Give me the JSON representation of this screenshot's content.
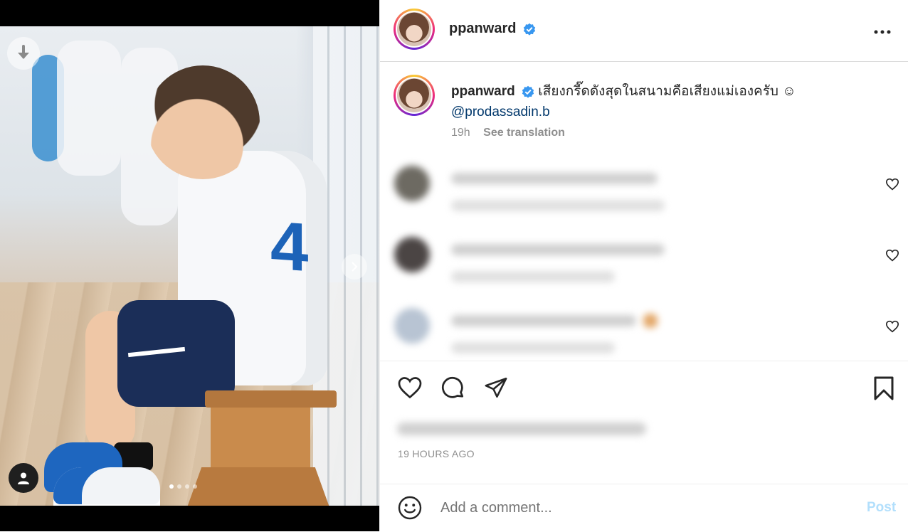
{
  "post": {
    "username": "ppanward",
    "caption": "เสียงกรี๊ดดังสุดในสนามคือเสียงแม่เองครับ ☺",
    "mention": "@prodassadin.b",
    "time_ago": "19h",
    "see_translation": "See translation",
    "timestamp": "19 HOURS AGO",
    "photo_number": "4",
    "carousel": {
      "total": 4,
      "active": 1
    }
  },
  "comment_bar": {
    "placeholder": "Add a comment...",
    "post_label": "Post"
  },
  "icons": {
    "verified": "verified-badge-icon",
    "more": "more-options-icon",
    "download": "download-icon",
    "next": "chevron-right-icon",
    "tag": "user-tag-icon",
    "like": "heart-icon",
    "comment": "comment-icon",
    "share": "share-icon",
    "save": "bookmark-icon",
    "emoji": "emoji-icon"
  },
  "colors": {
    "verified": "#3897f0",
    "link": "#00376b",
    "post_button": "#b2dffc",
    "muted_text": "#8e8e8e"
  }
}
